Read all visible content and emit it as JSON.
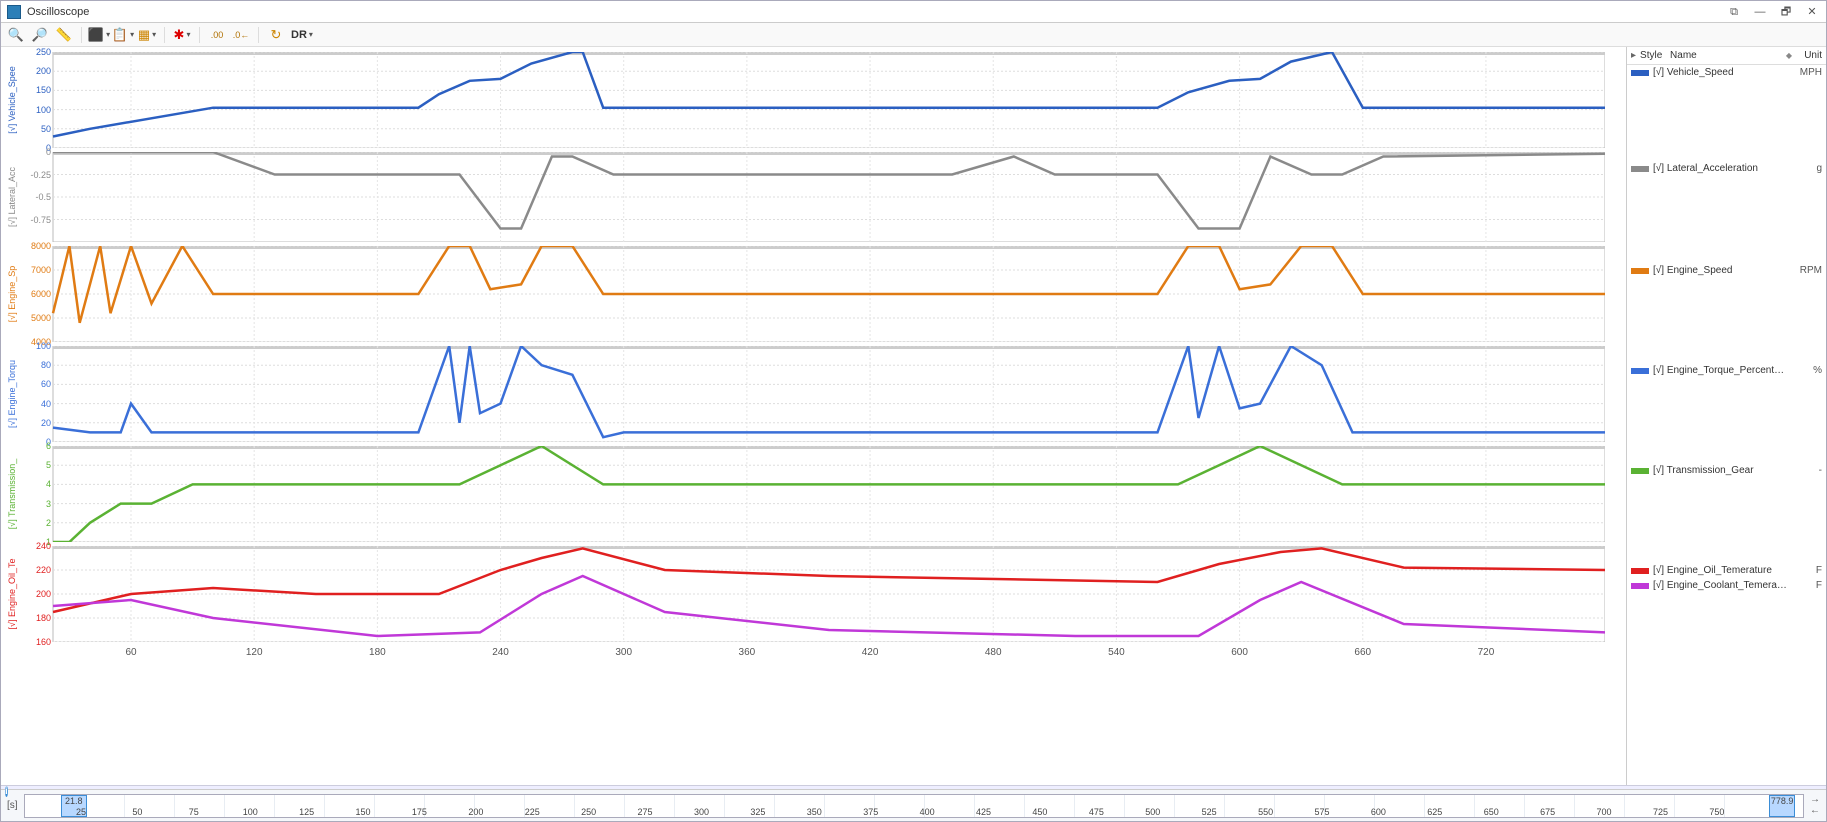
{
  "window": {
    "title": "Oscilloscope"
  },
  "toolbar": {
    "buttons": [
      {
        "name": "zoom-in-icon",
        "glyph": "🔍+"
      },
      {
        "name": "zoom-out-icon",
        "glyph": "🔍-"
      },
      {
        "name": "measure-icon",
        "glyph": "📏"
      },
      {
        "name": "chart-icon",
        "glyph": "📊"
      },
      {
        "name": "copy-icon",
        "glyph": "📋"
      },
      {
        "name": "grid-icon",
        "glyph": "▦"
      },
      {
        "name": "marker-icon",
        "glyph": "✳"
      },
      {
        "name": "decimal-less-icon",
        "glyph": ".00"
      },
      {
        "name": "decimal-more-icon",
        "glyph": ".0←"
      },
      {
        "name": "refresh-icon",
        "glyph": "↻"
      }
    ],
    "dr_label": "DR"
  },
  "legend": {
    "header": {
      "style": "Style",
      "name": "Name",
      "unit": "Unit"
    },
    "groups": [
      {
        "height": 96,
        "items": [
          {
            "color": "#2b5fc1",
            "label": "[√] Vehicle_Speed",
            "unit": "MPH"
          }
        ]
      },
      {
        "height": 102,
        "items": [
          {
            "color": "#8a8a8a",
            "label": "[√] Lateral_Acceleration",
            "unit": "g"
          }
        ]
      },
      {
        "height": 100,
        "items": [
          {
            "color": "#e07b13",
            "label": "[√] Engine_Speed",
            "unit": "RPM"
          }
        ]
      },
      {
        "height": 100,
        "items": [
          {
            "color": "#3a6fd8",
            "label": "[√] Engine_Torque_Percentage",
            "unit": "%"
          }
        ]
      },
      {
        "height": 100,
        "items": [
          {
            "color": "#5ab233",
            "label": "[√] Transmission_Gear",
            "unit": "-"
          }
        ]
      },
      {
        "height": 100,
        "items": [
          {
            "color": "#e02020",
            "label": "[√] Engine_Oil_Temerature",
            "unit": "F"
          },
          {
            "color": "#c038d8",
            "label": "[√] Engine_Coolant_Temerature",
            "unit": "F"
          }
        ]
      }
    ]
  },
  "x_axis": {
    "ticks": [
      60,
      120,
      180,
      240,
      300,
      360,
      420,
      480,
      540,
      600,
      660,
      720
    ]
  },
  "ruler": {
    "unit_label": "[s]",
    "marker_left": "21.8",
    "marker_right": "778.9",
    "ticks": [
      25,
      50,
      75,
      100,
      125,
      150,
      175,
      200,
      225,
      250,
      275,
      300,
      325,
      350,
      375,
      400,
      425,
      450,
      475,
      500,
      525,
      550,
      575,
      600,
      625,
      650,
      675,
      700,
      725,
      750
    ]
  },
  "chart_data": [
    {
      "type": "line",
      "name": "Vehicle_Speed",
      "color": "#2b5fc1",
      "ylabel": "[√] Vehicle_Spee",
      "ylim": [
        0,
        250
      ],
      "yticks": [
        0,
        50,
        100,
        150,
        200,
        250
      ],
      "x": [
        22,
        40,
        100,
        200,
        210,
        225,
        240,
        255,
        275,
        280,
        290,
        400,
        560,
        575,
        595,
        610,
        625,
        645,
        660,
        778
      ],
      "y": [
        30,
        50,
        105,
        105,
        140,
        175,
        180,
        220,
        250,
        250,
        105,
        105,
        105,
        145,
        175,
        180,
        225,
        250,
        105,
        105
      ]
    },
    {
      "type": "line",
      "name": "Lateral_Acceleration",
      "color": "#8a8a8a",
      "ylabel": "[√] Lateral_Acc",
      "ylim": [
        -1.0,
        0.0
      ],
      "yticks": [
        -0.75,
        -0.5,
        -0.25,
        0.0
      ],
      "x": [
        22,
        100,
        130,
        150,
        220,
        240,
        250,
        265,
        275,
        295,
        320,
        460,
        490,
        510,
        560,
        580,
        600,
        615,
        635,
        650,
        670,
        778
      ],
      "y": [
        0.0,
        0.0,
        -0.25,
        -0.25,
        -0.25,
        -0.85,
        -0.85,
        -0.05,
        -0.05,
        -0.25,
        -0.25,
        -0.25,
        -0.05,
        -0.25,
        -0.25,
        -0.85,
        -0.85,
        -0.05,
        -0.25,
        -0.25,
        -0.05,
        -0.02
      ]
    },
    {
      "type": "line",
      "name": "Engine_Speed",
      "color": "#e07b13",
      "ylabel": "[√] Engine_Sp",
      "ylim": [
        4000,
        8000
      ],
      "yticks": [
        4000,
        5000,
        6000,
        7000,
        8000
      ],
      "x": [
        22,
        30,
        35,
        45,
        50,
        60,
        70,
        85,
        100,
        200,
        215,
        225,
        235,
        250,
        260,
        275,
        290,
        300,
        560,
        575,
        590,
        600,
        615,
        630,
        645,
        660,
        778
      ],
      "y": [
        5200,
        8000,
        4800,
        8000,
        5200,
        8000,
        5600,
        8000,
        6000,
        6000,
        8000,
        8000,
        6200,
        6400,
        8000,
        8000,
        6000,
        6000,
        6000,
        8000,
        8000,
        6200,
        6400,
        8000,
        8000,
        6000,
        6000
      ]
    },
    {
      "type": "line",
      "name": "Engine_Torque_Percentage",
      "color": "#3a6fd8",
      "ylabel": "[√] Engine_Torqu",
      "ylim": [
        0,
        100
      ],
      "yticks": [
        0,
        20,
        40,
        60,
        80,
        100
      ],
      "x": [
        22,
        40,
        55,
        60,
        70,
        200,
        215,
        220,
        225,
        230,
        240,
        250,
        260,
        275,
        290,
        300,
        560,
        575,
        580,
        590,
        600,
        610,
        625,
        640,
        655,
        778
      ],
      "y": [
        15,
        10,
        10,
        40,
        10,
        10,
        100,
        20,
        100,
        30,
        40,
        100,
        80,
        70,
        5,
        10,
        10,
        100,
        25,
        100,
        35,
        40,
        100,
        80,
        10,
        10
      ]
    },
    {
      "type": "line",
      "name": "Transmission_Gear",
      "color": "#5ab233",
      "ylabel": "[√] Transmission_",
      "ylim": [
        1,
        6
      ],
      "yticks": [
        1,
        2,
        3,
        4,
        5,
        6
      ],
      "x": [
        22,
        30,
        40,
        55,
        70,
        90,
        110,
        220,
        240,
        260,
        290,
        570,
        590,
        610,
        650,
        778
      ],
      "y": [
        1,
        1,
        2,
        3,
        3,
        4,
        4,
        4,
        5,
        6,
        4,
        4,
        5,
        6,
        4,
        4
      ]
    },
    {
      "type": "line",
      "name": "Engine_Oil_Temerature",
      "color": "#e02020",
      "ylabel": "[√] Engine_Oil_Te",
      "ylim": [
        160,
        240
      ],
      "yticks": [
        160,
        180,
        200,
        220,
        240
      ],
      "x": [
        22,
        60,
        100,
        150,
        210,
        240,
        260,
        280,
        320,
        400,
        560,
        590,
        620,
        640,
        680,
        778
      ],
      "y": [
        185,
        200,
        205,
        200,
        200,
        220,
        230,
        238,
        220,
        215,
        210,
        225,
        235,
        238,
        222,
        220
      ]
    },
    {
      "type": "line",
      "name": "Engine_Coolant_Temerature",
      "color": "#c038d8",
      "ylabel": "",
      "ylim": [
        160,
        240
      ],
      "yticks": [],
      "x": [
        22,
        60,
        100,
        180,
        230,
        260,
        280,
        320,
        400,
        520,
        580,
        610,
        630,
        680,
        778
      ],
      "y": [
        190,
        195,
        180,
        165,
        168,
        200,
        215,
        185,
        170,
        165,
        165,
        195,
        210,
        175,
        168
      ]
    }
  ],
  "panes": [
    {
      "series": [
        0
      ],
      "height": 96
    },
    {
      "series": [
        1
      ],
      "height": 90
    },
    {
      "series": [
        2
      ],
      "height": 96
    },
    {
      "series": [
        3
      ],
      "height": 96
    },
    {
      "series": [
        4
      ],
      "height": 96
    },
    {
      "series": [
        5,
        6
      ],
      "height": 96
    }
  ],
  "plot_x_range": [
    22,
    778
  ]
}
